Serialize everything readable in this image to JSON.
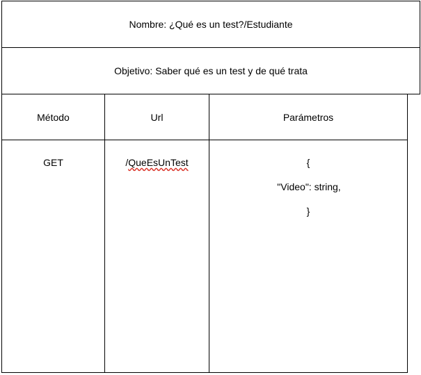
{
  "document": {
    "name_line": "Nombre: ¿Qué es un test?/Estudiante",
    "objective_line": "Objetivo: Saber  qué es un test y de qué trata",
    "table": {
      "headers": [
        "Método",
        "Url",
        "Parámetros"
      ],
      "row": {
        "method": "GET",
        "url_prefix": "/",
        "url_word": "QueEsUnTest",
        "params_lines": [
          "{",
          "\"Video\": string,",
          "}"
        ]
      }
    }
  }
}
